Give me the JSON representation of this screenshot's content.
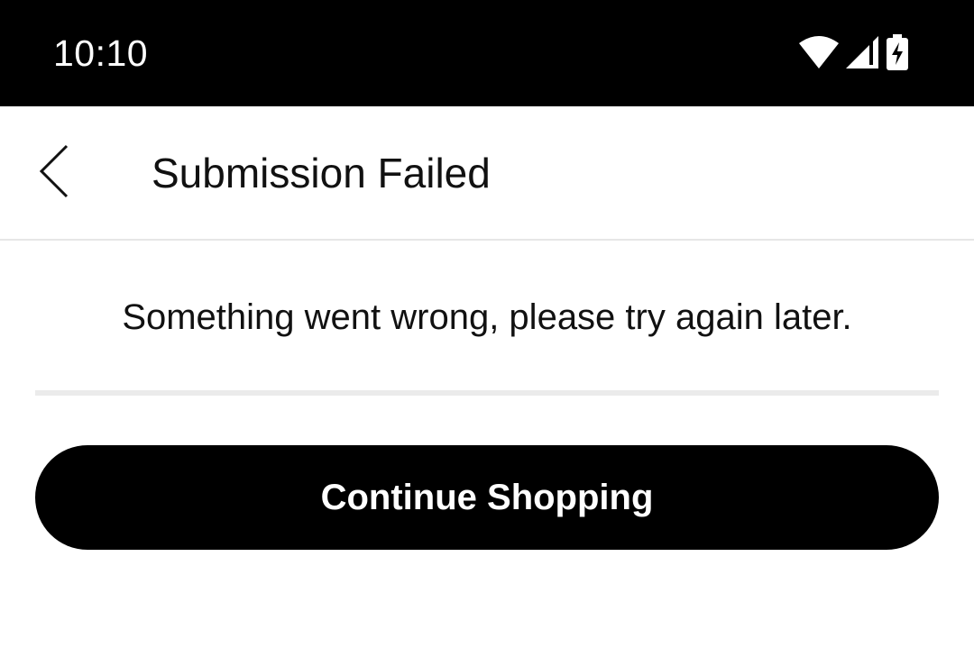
{
  "status_bar": {
    "time": "10:10",
    "icons": [
      "wifi-icon",
      "signal-icon",
      "battery-charging-icon"
    ]
  },
  "app_bar": {
    "back_icon": "chevron-left-icon",
    "title": "Submission Failed"
  },
  "main": {
    "message": "Something went wrong, please try again later.",
    "continue_button_label": "Continue Shopping"
  },
  "colors": {
    "status_bar_bg": "#000000",
    "button_bg": "#000000",
    "button_text": "#ffffff",
    "divider": "#ebebeb"
  }
}
